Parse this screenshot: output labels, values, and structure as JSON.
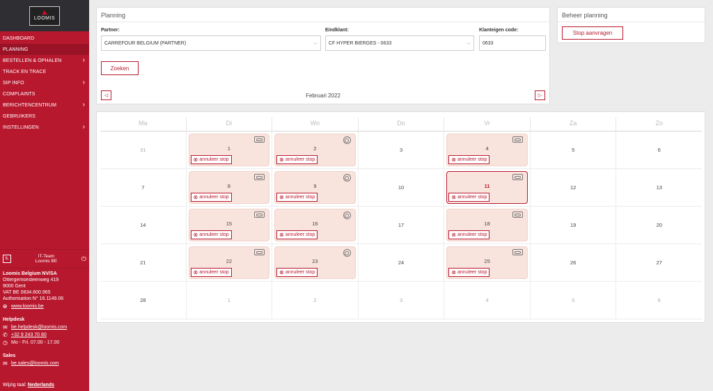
{
  "logo": {
    "text": "LOOMIS"
  },
  "nav": [
    {
      "label": "DASHBOARD",
      "chevron": false,
      "active": false
    },
    {
      "label": "PLANNING",
      "chevron": false,
      "active": true
    },
    {
      "label": "BESTELLEN & OPHALEN",
      "chevron": true,
      "active": false
    },
    {
      "label": "TRACK EN TRACE",
      "chevron": false,
      "active": false
    },
    {
      "label": "SIP INFO",
      "chevron": true,
      "active": false
    },
    {
      "label": "COMPLAINTS",
      "chevron": false,
      "active": false
    },
    {
      "label": "BERICHTENCENTRUM",
      "chevron": true,
      "active": false
    },
    {
      "label": "GEBRUIKERS",
      "chevron": false,
      "active": false
    },
    {
      "label": "INSTELLINGEN",
      "chevron": true,
      "active": false
    }
  ],
  "user": {
    "initial": "IL",
    "name_line1": "IT-Team",
    "name_line2": "Loomis BE"
  },
  "company": {
    "name": "Loomis Belgium NV/SA",
    "street": "Ottergemsesteenweg 419",
    "city": "9000 Gent",
    "vat": "VAT BE 0834.600.965",
    "auth": "Authorisation N° 16.1149.06",
    "website": "www.loomis.be"
  },
  "helpdesk": {
    "title": "Helpdesk",
    "email": "be.helpdesk@loomis.com",
    "phone": "+32 9 243 70 80",
    "hours": "Mo - Fri. 07.00 - 17.00"
  },
  "sales": {
    "title": "Sales",
    "email": "be.sales@loomis.com"
  },
  "language": {
    "label": "Wijzig taal:",
    "value": "Nederlands"
  },
  "planning": {
    "title": "Planning",
    "partner_label": "Partner:",
    "partner_value": "CARREFOUR BELGIUM (PARTNER)",
    "eindklant_label": "Eindklant:",
    "eindklant_value": "CF HYPER BIERGES - 0633",
    "code_label": "Klanteigen code:",
    "code_value": "0633",
    "search_label": "Zoeken",
    "month": "Februari 2022"
  },
  "beheer": {
    "title": "Beheer planning",
    "button": "Stop aanvragen"
  },
  "calendar": {
    "days": [
      "Ma",
      "Di",
      "Wo",
      "Do",
      "Vr",
      "Za",
      "Zo"
    ],
    "cancel_label": "annuleer stop",
    "weeks": [
      [
        {
          "d": "31",
          "m": true
        },
        {
          "d": "1",
          "ev": "rect"
        },
        {
          "d": "2",
          "ev": "circ"
        },
        {
          "d": "3"
        },
        {
          "d": "4",
          "ev": "rect"
        },
        {
          "d": "5"
        },
        {
          "d": "6"
        }
      ],
      [
        {
          "d": "7"
        },
        {
          "d": "8",
          "ev": "rect"
        },
        {
          "d": "9",
          "ev": "circ"
        },
        {
          "d": "10"
        },
        {
          "d": "11",
          "ev": "rect",
          "today": true
        },
        {
          "d": "12"
        },
        {
          "d": "13"
        }
      ],
      [
        {
          "d": "14"
        },
        {
          "d": "15",
          "ev": "rect"
        },
        {
          "d": "16",
          "ev": "circ"
        },
        {
          "d": "17"
        },
        {
          "d": "18",
          "ev": "rect"
        },
        {
          "d": "19"
        },
        {
          "d": "20"
        }
      ],
      [
        {
          "d": "21"
        },
        {
          "d": "22",
          "ev": "rect"
        },
        {
          "d": "23",
          "ev": "circ"
        },
        {
          "d": "24"
        },
        {
          "d": "25",
          "ev": "rect"
        },
        {
          "d": "26"
        },
        {
          "d": "27"
        }
      ],
      [
        {
          "d": "28"
        },
        {
          "d": "1",
          "m": true
        },
        {
          "d": "2",
          "m": true
        },
        {
          "d": "3",
          "m": true
        },
        {
          "d": "4",
          "m": true
        },
        {
          "d": "5",
          "m": true
        },
        {
          "d": "6",
          "m": true
        }
      ]
    ]
  }
}
